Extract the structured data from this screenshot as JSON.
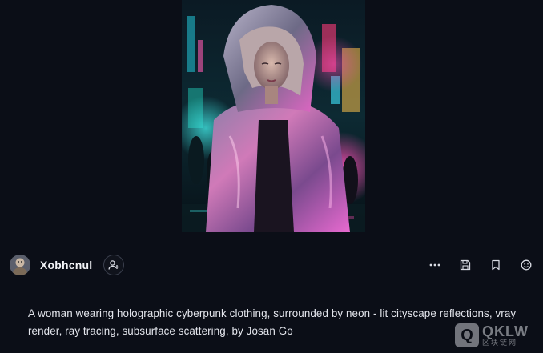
{
  "artwork": {
    "icon": "cyberpunk-portrait-image"
  },
  "user": {
    "name": "Xobhcnul",
    "avatar_icon": "user-avatar",
    "follow_icon": "add-user-icon"
  },
  "actions": {
    "more_icon": "more-dots-icon",
    "save_icon": "save-disk-icon",
    "bookmark_icon": "bookmark-icon",
    "emoji_icon": "smiley-icon"
  },
  "prompt": {
    "text": "A woman wearing holographic cyberpunk clothing, surrounded by neon - lit cityscape reflections, vray render, ray tracing, subsurface scattering, by Josan Go"
  },
  "watermark": {
    "mark": "Q",
    "brand": "QKLW",
    "sub": "区块链网"
  },
  "colors": {
    "background": "#0b0e17",
    "text": "#e3e5ec",
    "neon_pink": "#ff4fb8",
    "neon_cyan": "#3fe3e0"
  }
}
